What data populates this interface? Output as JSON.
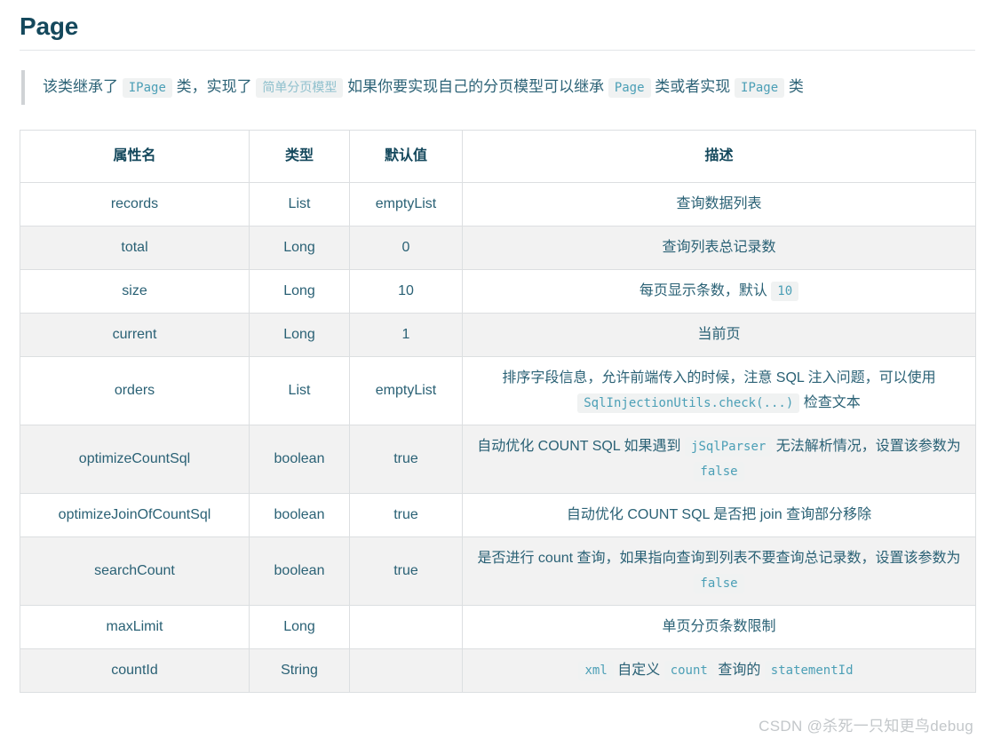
{
  "page": {
    "title": "Page",
    "watermark": "CSDN @杀死一只知更鸟debug"
  },
  "note": {
    "seg1": "该类继承了",
    "code1": "IPage",
    "seg2": "类，实现了",
    "code2": "简单分页模型",
    "seg3": "如果你要实现自己的分页模型可以继承",
    "code3": "Page",
    "seg4": "类或者实现",
    "code4": "IPage",
    "seg5": "类"
  },
  "table": {
    "headers": {
      "name": "属性名",
      "type": "类型",
      "default": "默认值",
      "description": "描述"
    },
    "rows": [
      {
        "name": "records",
        "type": "List",
        "default": "emptyList",
        "desc_parts": [
          {
            "kind": "text",
            "text": "查询数据列表"
          }
        ]
      },
      {
        "name": "total",
        "type": "Long",
        "default": "0",
        "desc_parts": [
          {
            "kind": "text",
            "text": "查询列表总记录数"
          }
        ]
      },
      {
        "name": "size",
        "type": "Long",
        "default": "10",
        "desc_parts": [
          {
            "kind": "text",
            "text": "每页显示条数，默认"
          },
          {
            "kind": "code",
            "text": "10"
          }
        ]
      },
      {
        "name": "current",
        "type": "Long",
        "default": "1",
        "desc_parts": [
          {
            "kind": "text",
            "text": "当前页"
          }
        ]
      },
      {
        "name": "orders",
        "type": "List",
        "default": "emptyList",
        "desc_parts": [
          {
            "kind": "text",
            "text": "排序字段信息，允许前端传入的时候，注意 SQL 注入问题，可以使用"
          },
          {
            "kind": "code",
            "text": "SqlInjectionUtils.check(...)"
          },
          {
            "kind": "text",
            "text": "检查文本"
          }
        ]
      },
      {
        "name": "optimizeCountSql",
        "type": "boolean",
        "default": "true",
        "desc_parts": [
          {
            "kind": "text",
            "text": "自动优化 COUNT SQL 如果遇到"
          },
          {
            "kind": "code",
            "text": "jSqlParser"
          },
          {
            "kind": "text",
            "text": "无法解析情况，设置该参数为"
          },
          {
            "kind": "code",
            "text": "false"
          }
        ]
      },
      {
        "name": "optimizeJoinOfCountSql",
        "type": "boolean",
        "default": "true",
        "desc_parts": [
          {
            "kind": "text",
            "text": "自动优化 COUNT SQL 是否把 join 查询部分移除"
          }
        ]
      },
      {
        "name": "searchCount",
        "type": "boolean",
        "default": "true",
        "desc_parts": [
          {
            "kind": "text",
            "text": "是否进行 count 查询，如果指向查询到列表不要查询总记录数，设置该参数为"
          },
          {
            "kind": "code",
            "text": "false"
          }
        ]
      },
      {
        "name": "maxLimit",
        "type": "Long",
        "default": "",
        "desc_parts": [
          {
            "kind": "text",
            "text": "单页分页条数限制"
          }
        ]
      },
      {
        "name": "countId",
        "type": "String",
        "default": "",
        "desc_parts": [
          {
            "kind": "code",
            "text": "xml"
          },
          {
            "kind": "text",
            "text": "自定义"
          },
          {
            "kind": "code",
            "text": "count"
          },
          {
            "kind": "text",
            "text": "查询的"
          },
          {
            "kind": "code",
            "text": "statementId"
          }
        ]
      }
    ]
  },
  "colors": {
    "heading": "#14485c",
    "body_text": "#2a6175",
    "code_text": "#4b9fb6",
    "code_bg": "#f0f2f2",
    "row_stripe": "#f2f2f2",
    "border": "#dcdfe1",
    "quote_bar": "#d0d3d6",
    "watermark": "#c3c7ca"
  }
}
